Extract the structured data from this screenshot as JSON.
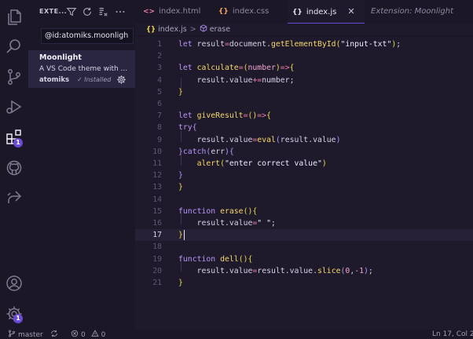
{
  "activity_bar": {
    "extensions_badge": "1",
    "settings_badge": "1"
  },
  "sidebar": {
    "title": "EXTE...",
    "search_value": "@id:atomiks.moonligh",
    "extension": {
      "name": "Moonlight",
      "description": "A VS Code theme with ...",
      "author": "atomiks",
      "installed_label": "✓ Installed"
    }
  },
  "tabs": [
    {
      "icon": "<>",
      "label": "index.html",
      "icon_color": "#f07fab"
    },
    {
      "icon": "{}",
      "label": "index.css",
      "icon_color": "#f5a25d"
    },
    {
      "icon": "{}",
      "label": "index.js",
      "icon_color": "#f0d94d",
      "active": true,
      "close": "✕"
    },
    {
      "label": "Extension: Moonlight",
      "preview": true
    }
  ],
  "breadcrumb": {
    "file": "index.js",
    "file_icon": "{}",
    "separator": ">",
    "symbol": "erase"
  },
  "editor": {
    "current_line": 17,
    "lines": [
      {
        "n": "1",
        "tokens": [
          [
            "kw",
            "let "
          ],
          [
            "plain",
            "result"
          ],
          [
            "op",
            "="
          ],
          [
            "plain",
            "document"
          ],
          [
            "dot",
            "."
          ],
          [
            "fn",
            "getElementById"
          ],
          [
            "brace",
            "("
          ],
          [
            "str",
            "\"input-txt\""
          ],
          [
            "brace",
            ")"
          ],
          [
            "plain",
            ";"
          ]
        ]
      },
      {
        "n": "2",
        "tokens": []
      },
      {
        "n": "3",
        "tokens": [
          [
            "kw",
            "let "
          ],
          [
            "fn",
            "calculate"
          ],
          [
            "op",
            "="
          ],
          [
            "brace",
            "("
          ],
          [
            "param",
            "number"
          ],
          [
            "brace",
            ")"
          ],
          [
            "op",
            "=>"
          ],
          [
            "brace",
            "{"
          ]
        ]
      },
      {
        "n": "4",
        "tokens": [
          [
            "plain",
            "    result"
          ],
          [
            "dot",
            "."
          ],
          [
            "plain",
            "value"
          ],
          [
            "op",
            "+="
          ],
          [
            "plain",
            "number"
          ],
          [
            "plain",
            ";"
          ]
        ]
      },
      {
        "n": "5",
        "tokens": [
          [
            "brace",
            "}"
          ]
        ]
      },
      {
        "n": "6",
        "tokens": []
      },
      {
        "n": "7",
        "tokens": [
          [
            "kw",
            "let "
          ],
          [
            "fn",
            "giveResult"
          ],
          [
            "op",
            "="
          ],
          [
            "brace",
            "()"
          ],
          [
            "op",
            "=>"
          ],
          [
            "brace",
            "{"
          ]
        ]
      },
      {
        "n": "8",
        "tokens": [
          [
            "kw",
            "try"
          ],
          [
            "punc",
            "{"
          ]
        ]
      },
      {
        "n": "9",
        "tokens": [
          [
            "plain",
            "    result"
          ],
          [
            "dot",
            "."
          ],
          [
            "plain",
            "value"
          ],
          [
            "op",
            "="
          ],
          [
            "fn",
            "eval"
          ],
          [
            "punc",
            "("
          ],
          [
            "plain",
            "result"
          ],
          [
            "dot",
            "."
          ],
          [
            "plain",
            "value"
          ],
          [
            "punc",
            ")"
          ]
        ]
      },
      {
        "n": "10",
        "tokens": [
          [
            "punc",
            "}"
          ],
          [
            "kw",
            "catch"
          ],
          [
            "punc",
            "("
          ],
          [
            "plain",
            "err"
          ],
          [
            "punc",
            ")"
          ],
          [
            "punc",
            "{"
          ]
        ]
      },
      {
        "n": "11",
        "tokens": [
          [
            "plain",
            "    "
          ],
          [
            "fn",
            "alert"
          ],
          [
            "brace",
            "("
          ],
          [
            "str",
            "\"enter correct value\""
          ],
          [
            "brace",
            ")"
          ]
        ]
      },
      {
        "n": "12",
        "tokens": [
          [
            "punc",
            "}"
          ]
        ]
      },
      {
        "n": "13",
        "tokens": [
          [
            "brace",
            "}"
          ]
        ]
      },
      {
        "n": "14",
        "tokens": []
      },
      {
        "n": "15",
        "tokens": [
          [
            "kw",
            "function "
          ],
          [
            "fn",
            "erase"
          ],
          [
            "brace",
            "(){"
          ]
        ]
      },
      {
        "n": "16",
        "tokens": [
          [
            "plain",
            "    result"
          ],
          [
            "dot",
            "."
          ],
          [
            "plain",
            "value"
          ],
          [
            "op",
            "="
          ],
          [
            "str",
            "\" \""
          ],
          [
            "plain",
            ";"
          ]
        ]
      },
      {
        "n": "17",
        "tokens": [
          [
            "brace",
            "}"
          ]
        ]
      },
      {
        "n": "18",
        "tokens": []
      },
      {
        "n": "19",
        "tokens": [
          [
            "kw",
            "function "
          ],
          [
            "fn",
            "dell"
          ],
          [
            "brace",
            "(){"
          ]
        ]
      },
      {
        "n": "20",
        "tokens": [
          [
            "plain",
            "    result"
          ],
          [
            "dot",
            "."
          ],
          [
            "plain",
            "value"
          ],
          [
            "op",
            "="
          ],
          [
            "plain",
            "result"
          ],
          [
            "dot",
            "."
          ],
          [
            "plain",
            "value"
          ],
          [
            "dot",
            "."
          ],
          [
            "fn",
            "slice"
          ],
          [
            "punc",
            "("
          ],
          [
            "num",
            "0"
          ],
          [
            "plain",
            ","
          ],
          [
            "num",
            "-1"
          ],
          [
            "punc",
            ")"
          ],
          [
            "plain",
            ";"
          ]
        ]
      },
      {
        "n": "21",
        "tokens": [
          [
            "brace",
            "}"
          ]
        ]
      }
    ]
  },
  "status_bar": {
    "branch": "master",
    "errors": "0",
    "warnings": "0",
    "position": "Ln 17, Col 2"
  },
  "colors": {
    "accent": "#6a4bd8",
    "background": "#1e1a2b",
    "sidebar": "#1b1727"
  }
}
